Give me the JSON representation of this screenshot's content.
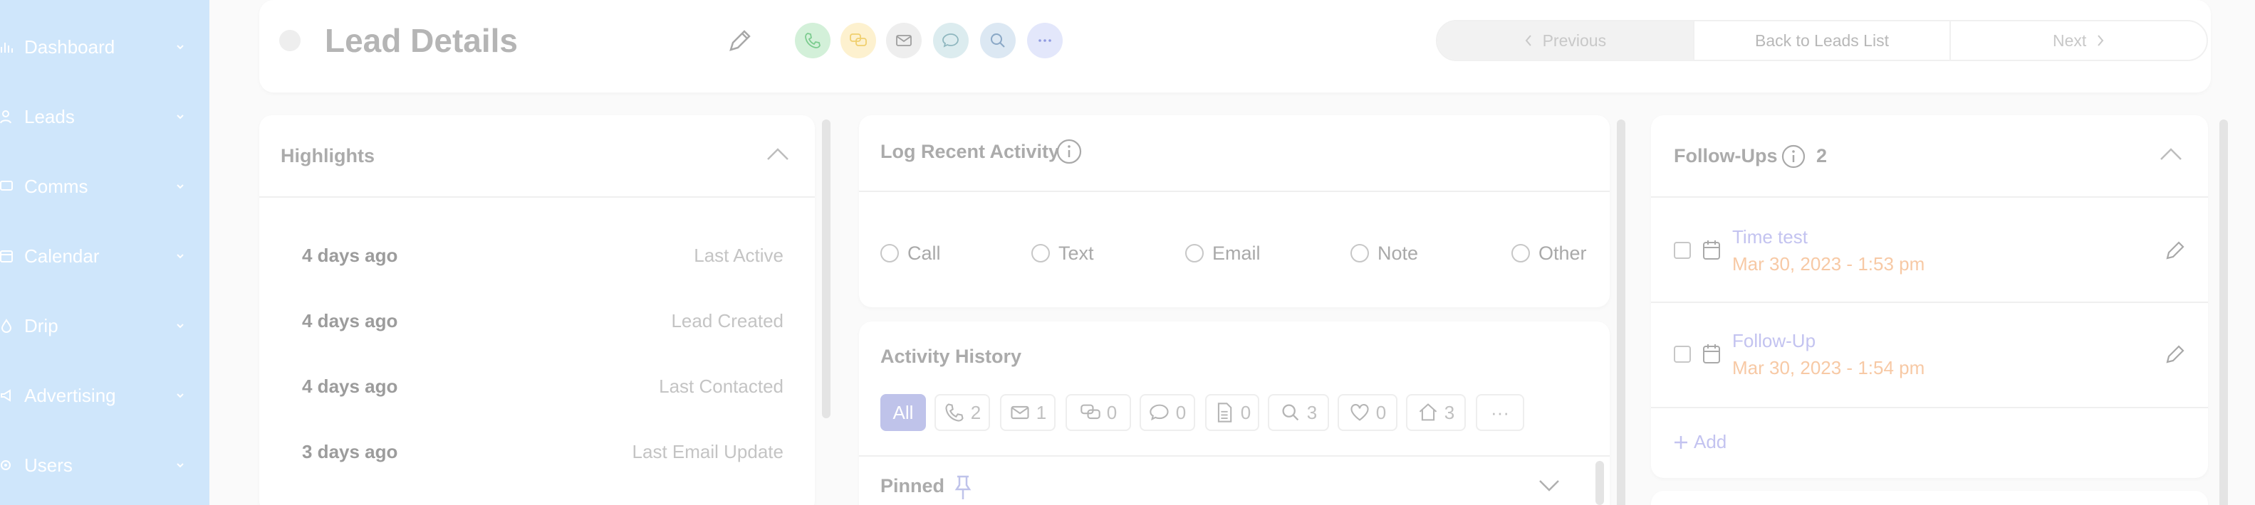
{
  "sidebar": {
    "items": [
      {
        "label": "Dashboard",
        "icon": "bar-chart-icon"
      },
      {
        "label": "Leads",
        "icon": "person-icon"
      },
      {
        "label": "Comms",
        "icon": "message-icon"
      },
      {
        "label": "Calendar",
        "icon": "calendar-icon"
      },
      {
        "label": "Drip",
        "icon": "drop-icon"
      },
      {
        "label": "Advertising",
        "icon": "megaphone-icon"
      },
      {
        "label": "Users",
        "icon": "users-icon"
      }
    ]
  },
  "header": {
    "title": "Lead Details",
    "quick_actions": [
      {
        "icon": "phone-icon",
        "color": "#d3f0d9",
        "stroke": "#7ccc8f"
      },
      {
        "icon": "chat-icon",
        "color": "#fdf1cf",
        "stroke": "#f0cf6e"
      },
      {
        "icon": "email-icon",
        "color": "#eeeeee",
        "stroke": "#9e9e9e"
      },
      {
        "icon": "comment-icon",
        "color": "#dcecef",
        "stroke": "#8fb7bf"
      },
      {
        "icon": "search-icon",
        "color": "#dce8f3",
        "stroke": "#8aa8c6"
      },
      {
        "icon": "more-icon",
        "color": "#e3e7fb",
        "stroke": "#8f9ae0"
      }
    ],
    "pager": {
      "previous": "Previous",
      "back": "Back to Leads List",
      "next": "Next"
    }
  },
  "highlights": {
    "title": "Highlights",
    "rows": [
      {
        "when": "4 days ago",
        "what": "Last Active"
      },
      {
        "when": "4 days ago",
        "what": "Lead Created"
      },
      {
        "when": "4 days ago",
        "what": "Last Contacted"
      },
      {
        "when": "3 days ago",
        "what": "Last Email Update"
      }
    ]
  },
  "log_activity": {
    "title": "Log Recent Activity",
    "options": [
      "Call",
      "Text",
      "Email",
      "Note",
      "Other"
    ]
  },
  "activity_history": {
    "title": "Activity History",
    "filters": [
      {
        "label": "All",
        "count": "",
        "icon": ""
      },
      {
        "label": "",
        "count": "2",
        "icon": "phone-icon"
      },
      {
        "label": "",
        "count": "1",
        "icon": "email-icon"
      },
      {
        "label": "",
        "count": "0",
        "icon": "chat-icon"
      },
      {
        "label": "",
        "count": "0",
        "icon": "comment-icon"
      },
      {
        "label": "",
        "count": "0",
        "icon": "document-icon"
      },
      {
        "label": "",
        "count": "3",
        "icon": "search-icon"
      },
      {
        "label": "",
        "count": "0",
        "icon": "heart-icon"
      },
      {
        "label": "",
        "count": "3",
        "icon": "home-icon"
      },
      {
        "label": "···",
        "count": "",
        "icon": "more-icon"
      }
    ],
    "pinned_label": "Pinned"
  },
  "followups": {
    "title": "Follow-Ups",
    "count": "2",
    "items": [
      {
        "title": "Time test",
        "date": "Mar 30, 2023 - 1:53 pm"
      },
      {
        "title": "Follow-Up",
        "date": "Mar 30, 2023 - 1:54 pm"
      }
    ],
    "add_label": "Add"
  }
}
